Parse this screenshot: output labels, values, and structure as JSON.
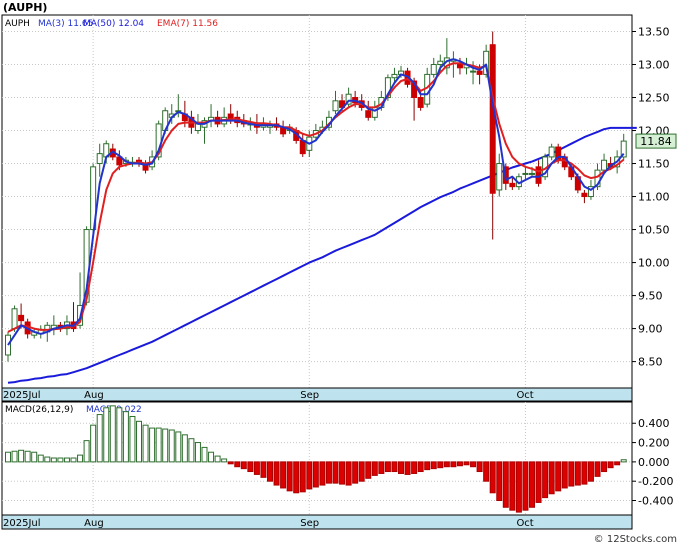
{
  "header": {
    "symbol_label": "(AUPH)"
  },
  "copyright": "© 12Stocks.com",
  "colors": {
    "up_candle": "#2e6e2e",
    "down_candle": "#cc0000",
    "ma3": "#2233cc",
    "ma50": "#1a1adb",
    "ema7": "#e02020",
    "date_band": "#bfe3ee",
    "price_tag_bg": "#d6f0d6",
    "macd_up": "#2e6e2e",
    "macd_down": "#dd0000"
  },
  "price_legend": [
    {
      "key": "label",
      "text": "AUPH"
    },
    {
      "key": "ma3",
      "text": "MA(3) 11.65"
    },
    {
      "key": "ma50",
      "text": "MA(50) 12.04"
    },
    {
      "key": "ema7",
      "text": "EMA(7) 11.56"
    }
  ],
  "macd_legend": [
    {
      "key": "label",
      "text": "MACD(26,12,9)"
    },
    {
      "key": "value",
      "text": "MACD:0.022"
    }
  ],
  "chart_data": [
    {
      "type": "candlestick",
      "name": "price",
      "ylim": [
        8.1,
        13.75
      ],
      "y_ticks": [
        "13.50",
        "13.00",
        "12.50",
        "12.00",
        "11.50",
        "11.00",
        "10.50",
        "10.00",
        "9.50",
        "9.00",
        "8.50"
      ],
      "last_price": "11.84",
      "x_tick_labels": [
        {
          "label": "2025Jul",
          "index": 0
        },
        {
          "label": "Aug",
          "index": 13
        },
        {
          "label": "Sep",
          "index": 46
        },
        {
          "label": "Oct",
          "index": 79
        }
      ],
      "candles": [
        [
          8.6,
          8.9,
          8.5,
          8.95
        ],
        [
          9.0,
          9.3,
          8.95,
          9.35
        ],
        [
          9.2,
          9.12,
          9.0,
          9.38
        ],
        [
          9.1,
          8.92,
          8.85,
          9.15
        ],
        [
          8.9,
          8.95,
          8.85,
          9.0
        ],
        [
          8.92,
          8.98,
          8.85,
          9.05
        ],
        [
          8.95,
          9.05,
          8.8,
          9.1
        ],
        [
          9.0,
          9.05,
          8.9,
          9.2
        ],
        [
          9.05,
          9.02,
          8.95,
          9.1
        ],
        [
          9.0,
          9.1,
          8.9,
          9.2
        ],
        [
          9.1,
          9.0,
          8.95,
          9.4
        ],
        [
          9.05,
          9.35,
          9.0,
          9.85
        ],
        [
          9.4,
          10.5,
          9.35,
          10.55
        ],
        [
          10.5,
          11.45,
          10.4,
          11.5
        ],
        [
          11.5,
          11.65,
          11.3,
          11.8
        ],
        [
          11.6,
          11.8,
          11.5,
          11.85
        ],
        [
          11.72,
          11.6,
          11.55,
          11.8
        ],
        [
          11.6,
          11.48,
          11.4,
          11.7
        ],
        [
          11.5,
          11.55,
          11.45,
          11.6
        ],
        [
          11.5,
          11.52,
          11.45,
          11.6
        ],
        [
          11.55,
          11.5,
          11.45,
          11.6
        ],
        [
          11.5,
          11.4,
          11.35,
          11.55
        ],
        [
          11.45,
          11.6,
          11.4,
          11.7
        ],
        [
          11.6,
          12.1,
          11.55,
          12.15
        ],
        [
          12.0,
          12.3,
          11.95,
          12.35
        ],
        [
          12.2,
          12.25,
          12.1,
          12.4
        ],
        [
          12.3,
          12.3,
          12.2,
          12.55
        ],
        [
          12.25,
          12.15,
          12.05,
          12.45
        ],
        [
          12.2,
          12.05,
          11.95,
          12.3
        ],
        [
          12.0,
          12.1,
          11.95,
          12.25
        ],
        [
          12.05,
          12.15,
          11.8,
          12.2
        ],
        [
          12.15,
          12.2,
          12.05,
          12.4
        ],
        [
          12.2,
          12.1,
          12.05,
          12.3
        ],
        [
          12.1,
          12.2,
          12.05,
          12.35
        ],
        [
          12.25,
          12.15,
          12.1,
          12.4
        ],
        [
          12.2,
          12.12,
          12.05,
          12.3
        ],
        [
          12.15,
          12.1,
          12.05,
          12.25
        ],
        [
          12.1,
          12.1,
          12.0,
          12.2
        ],
        [
          12.1,
          12.05,
          11.95,
          12.25
        ],
        [
          12.05,
          12.1,
          12.0,
          12.2
        ],
        [
          12.05,
          12.08,
          11.95,
          12.15
        ],
        [
          12.1,
          12.05,
          12.0,
          12.2
        ],
        [
          12.05,
          11.95,
          11.9,
          12.15
        ],
        [
          12.0,
          12.05,
          11.95,
          12.1
        ],
        [
          12.0,
          11.85,
          11.8,
          12.05
        ],
        [
          11.85,
          11.65,
          11.6,
          11.95
        ],
        [
          11.7,
          11.9,
          11.6,
          12.0
        ],
        [
          11.9,
          12.0,
          11.85,
          12.1
        ],
        [
          12.0,
          12.05,
          11.95,
          12.15
        ],
        [
          12.05,
          12.2,
          12.0,
          12.3
        ],
        [
          12.3,
          12.45,
          12.25,
          12.6
        ],
        [
          12.45,
          12.35,
          12.3,
          12.55
        ],
        [
          12.4,
          12.55,
          12.35,
          12.65
        ],
        [
          12.5,
          12.42,
          12.35,
          12.6
        ],
        [
          12.45,
          12.35,
          12.3,
          12.55
        ],
        [
          12.3,
          12.2,
          12.15,
          12.45
        ],
        [
          12.2,
          12.35,
          12.15,
          12.45
        ],
        [
          12.35,
          12.5,
          12.3,
          12.6
        ],
        [
          12.5,
          12.8,
          12.45,
          12.85
        ],
        [
          12.8,
          12.85,
          12.7,
          12.95
        ],
        [
          12.85,
          12.9,
          12.8,
          12.98
        ],
        [
          12.9,
          12.7,
          12.65,
          12.95
        ],
        [
          12.75,
          12.5,
          12.15,
          12.8
        ],
        [
          12.5,
          12.35,
          12.3,
          12.6
        ],
        [
          12.4,
          12.85,
          12.35,
          12.95
        ],
        [
          12.85,
          13.0,
          12.8,
          13.1
        ],
        [
          13.0,
          13.05,
          12.9,
          13.15
        ],
        [
          12.95,
          13.1,
          12.85,
          13.4
        ],
        [
          13.05,
          13.08,
          12.8,
          13.2
        ],
        [
          13.0,
          12.95,
          12.85,
          13.1
        ],
        [
          12.95,
          13.0,
          12.85,
          13.1
        ],
        [
          12.9,
          12.9,
          12.7,
          13.05
        ],
        [
          12.9,
          12.85,
          12.7,
          13.0
        ],
        [
          12.85,
          13.2,
          12.8,
          13.3
        ],
        [
          13.3,
          11.05,
          10.35,
          13.5
        ],
        [
          11.1,
          11.5,
          11.0,
          11.65
        ],
        [
          11.45,
          11.2,
          11.1,
          11.5
        ],
        [
          11.2,
          11.15,
          11.1,
          11.3
        ],
        [
          11.15,
          11.3,
          11.1,
          11.35
        ],
        [
          11.35,
          11.35,
          11.25,
          11.45
        ],
        [
          11.35,
          11.35,
          11.3,
          11.45
        ],
        [
          11.45,
          11.2,
          11.15,
          11.55
        ],
        [
          11.3,
          11.6,
          11.25,
          11.65
        ],
        [
          11.6,
          11.75,
          11.55,
          11.8
        ],
        [
          11.75,
          11.55,
          11.5,
          11.8
        ],
        [
          11.6,
          11.45,
          11.4,
          11.65
        ],
        [
          11.45,
          11.3,
          11.25,
          11.5
        ],
        [
          11.3,
          11.1,
          11.05,
          11.35
        ],
        [
          11.05,
          11.0,
          10.9,
          11.1
        ],
        [
          11.0,
          11.15,
          10.95,
          11.25
        ],
        [
          11.15,
          11.4,
          11.1,
          11.5
        ],
        [
          11.4,
          11.55,
          11.35,
          11.65
        ],
        [
          11.5,
          11.45,
          11.4,
          11.6
        ],
        [
          11.45,
          11.6,
          11.35,
          11.7
        ],
        [
          11.6,
          11.84,
          11.55,
          11.95
        ]
      ],
      "ma50": [
        8.18,
        8.19,
        8.21,
        8.22,
        8.24,
        8.25,
        8.27,
        8.28,
        8.3,
        8.31,
        8.34,
        8.37,
        8.4,
        8.44,
        8.48,
        8.52,
        8.56,
        8.6,
        8.64,
        8.68,
        8.72,
        8.76,
        8.8,
        8.85,
        8.9,
        8.95,
        9.0,
        9.05,
        9.1,
        9.15,
        9.2,
        9.25,
        9.3,
        9.35,
        9.4,
        9.45,
        9.5,
        9.55,
        9.6,
        9.65,
        9.7,
        9.75,
        9.8,
        9.85,
        9.9,
        9.95,
        10.0,
        10.04,
        10.08,
        10.13,
        10.18,
        10.22,
        10.26,
        10.3,
        10.34,
        10.38,
        10.42,
        10.48,
        10.54,
        10.6,
        10.66,
        10.72,
        10.78,
        10.84,
        10.89,
        10.94,
        10.99,
        11.03,
        11.07,
        11.12,
        11.16,
        11.2,
        11.24,
        11.28,
        11.32,
        11.36,
        11.4,
        11.44,
        11.47,
        11.5,
        11.53,
        11.57,
        11.61,
        11.65,
        11.7,
        11.75,
        11.8,
        11.85,
        11.9,
        11.94,
        11.98,
        12.02,
        12.04,
        12.04,
        12.04,
        12.04,
        12.04
      ],
      "ma3": [
        8.75,
        8.9,
        9.05,
        9.0,
        8.95,
        8.92,
        8.95,
        9.0,
        9.02,
        9.05,
        9.04,
        9.15,
        9.6,
        10.4,
        11.2,
        11.6,
        11.68,
        11.62,
        11.53,
        11.5,
        11.5,
        11.48,
        11.5,
        11.7,
        12.0,
        12.2,
        12.28,
        12.25,
        12.18,
        12.1,
        12.1,
        12.15,
        12.15,
        12.15,
        12.15,
        12.15,
        12.12,
        12.1,
        12.08,
        12.08,
        12.08,
        12.08,
        12.05,
        12.02,
        11.95,
        11.85,
        11.8,
        11.85,
        11.98,
        12.08,
        12.22,
        12.33,
        12.45,
        12.45,
        12.42,
        12.33,
        12.3,
        12.35,
        12.55,
        12.72,
        12.85,
        12.82,
        12.72,
        12.55,
        12.55,
        12.7,
        12.95,
        13.05,
        13.08,
        13.05,
        13.0,
        12.95,
        12.92,
        13.0,
        12.4,
        11.9,
        11.25,
        11.3,
        11.2,
        11.25,
        11.3,
        11.3,
        11.35,
        11.5,
        11.6,
        11.6,
        11.45,
        11.3,
        11.15,
        11.1,
        11.18,
        11.35,
        11.47,
        11.53,
        11.65
      ],
      "ema7": [
        8.95,
        9.0,
        9.05,
        9.03,
        9.0,
        8.98,
        8.98,
        8.99,
        9.0,
        9.02,
        9.03,
        9.1,
        9.45,
        10.0,
        10.6,
        11.1,
        11.35,
        11.45,
        11.48,
        11.5,
        11.52,
        11.5,
        11.52,
        11.65,
        11.85,
        12.0,
        12.1,
        12.12,
        12.12,
        12.12,
        12.12,
        12.15,
        12.15,
        12.16,
        12.17,
        12.17,
        12.15,
        12.13,
        12.11,
        12.11,
        12.1,
        12.08,
        12.05,
        12.05,
        12.0,
        11.95,
        11.92,
        11.95,
        12.0,
        12.1,
        12.2,
        12.28,
        12.35,
        12.4,
        12.4,
        12.35,
        12.35,
        12.4,
        12.52,
        12.65,
        12.75,
        12.78,
        12.72,
        12.6,
        12.65,
        12.75,
        12.88,
        12.98,
        13.02,
        13.02,
        13.0,
        12.98,
        12.95,
        12.98,
        12.5,
        12.1,
        11.8,
        11.6,
        11.5,
        11.45,
        11.42,
        11.38,
        11.42,
        11.5,
        11.55,
        11.55,
        11.5,
        11.42,
        11.32,
        11.28,
        11.3,
        11.38,
        11.42,
        11.48,
        11.56
      ]
    },
    {
      "type": "bar",
      "name": "macd",
      "ylim": [
        -0.55,
        0.62
      ],
      "y_ticks": [
        "0.400",
        "0.200",
        "0.000",
        "-0.200",
        "-0.400"
      ],
      "x_tick_labels": [
        {
          "label": "2025Jul",
          "index": 0
        },
        {
          "label": "Aug",
          "index": 13
        },
        {
          "label": "Sep",
          "index": 46
        },
        {
          "label": "Oct",
          "index": 79
        }
      ],
      "values": [
        0.1,
        0.11,
        0.12,
        0.11,
        0.1,
        0.07,
        0.05,
        0.04,
        0.04,
        0.04,
        0.04,
        0.07,
        0.22,
        0.38,
        0.49,
        0.56,
        0.58,
        0.56,
        0.52,
        0.47,
        0.42,
        0.38,
        0.35,
        0.35,
        0.34,
        0.33,
        0.31,
        0.28,
        0.24,
        0.2,
        0.15,
        0.1,
        0.06,
        0.03,
        -0.02,
        -0.05,
        -0.07,
        -0.1,
        -0.13,
        -0.16,
        -0.2,
        -0.24,
        -0.27,
        -0.3,
        -0.32,
        -0.31,
        -0.28,
        -0.26,
        -0.24,
        -0.22,
        -0.22,
        -0.23,
        -0.24,
        -0.22,
        -0.2,
        -0.17,
        -0.14,
        -0.12,
        -0.1,
        -0.1,
        -0.12,
        -0.13,
        -0.12,
        -0.1,
        -0.08,
        -0.07,
        -0.06,
        -0.05,
        -0.05,
        -0.04,
        -0.03,
        -0.05,
        -0.1,
        -0.2,
        -0.32,
        -0.4,
        -0.47,
        -0.5,
        -0.52,
        -0.5,
        -0.47,
        -0.42,
        -0.37,
        -0.33,
        -0.3,
        -0.27,
        -0.25,
        -0.24,
        -0.23,
        -0.2,
        -0.15,
        -0.1,
        -0.06,
        -0.03,
        0.022
      ]
    }
  ]
}
